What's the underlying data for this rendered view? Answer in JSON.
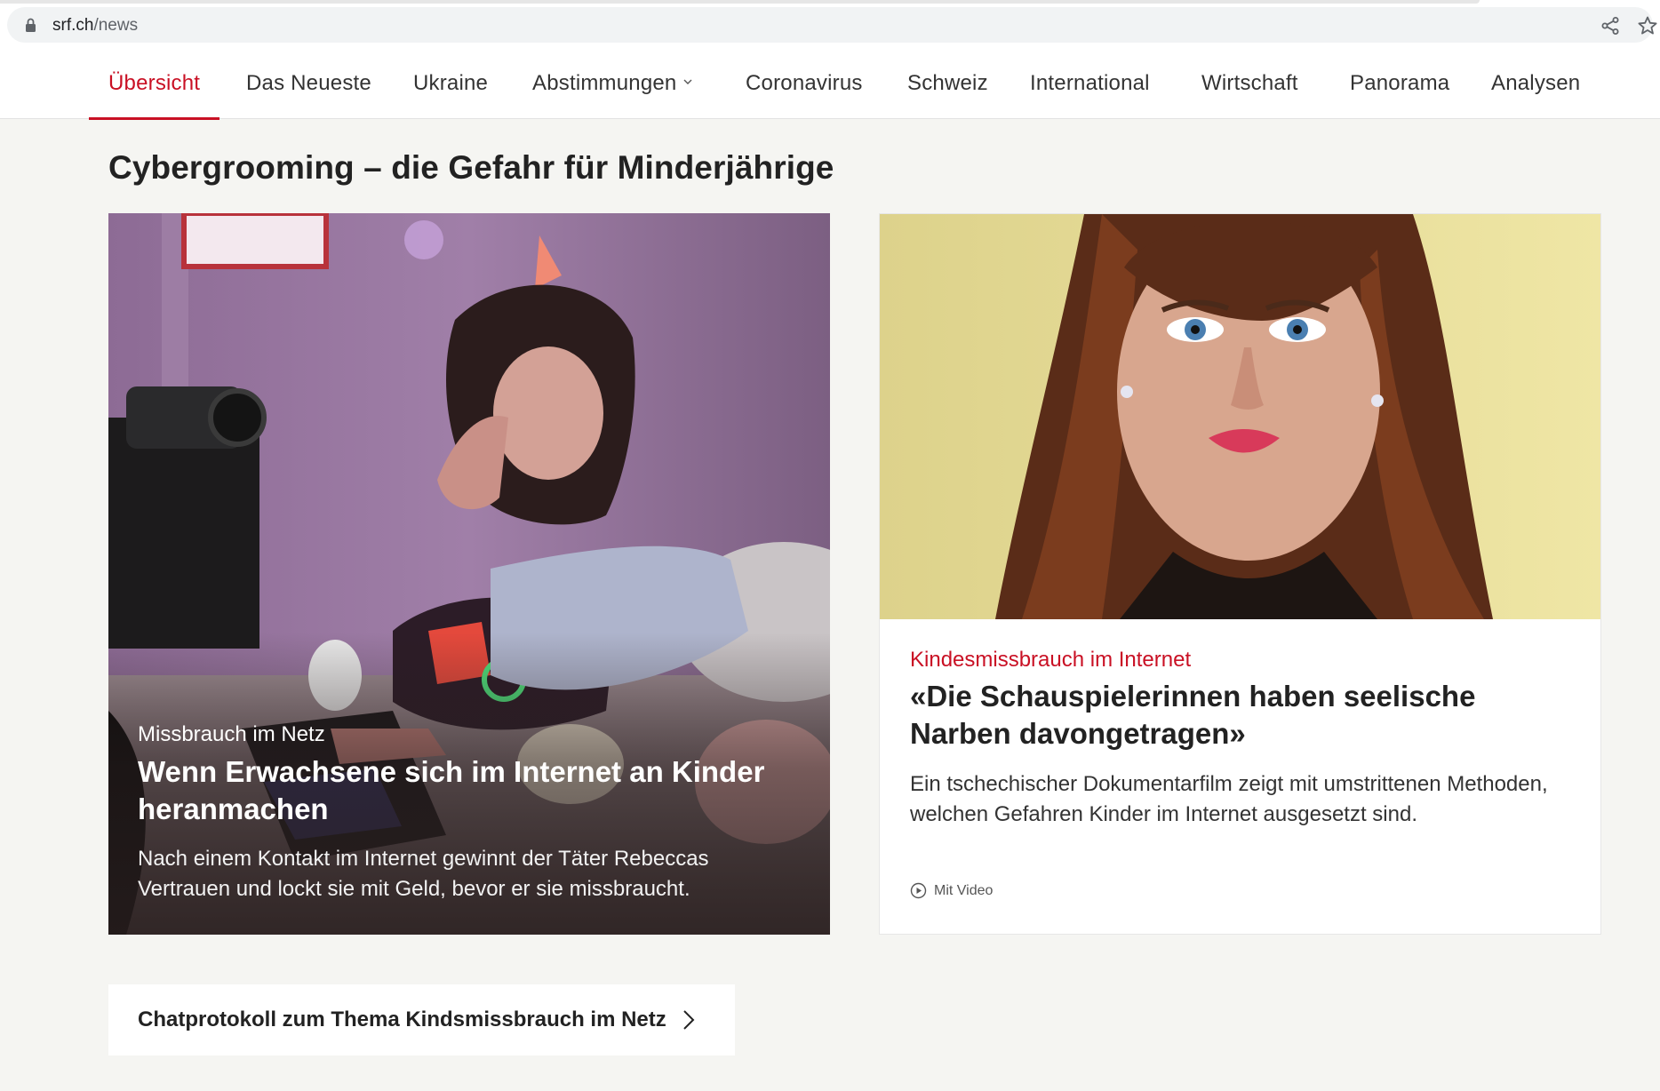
{
  "browser": {
    "url_domain": "srf.ch",
    "url_path": "/news",
    "icons": [
      "lock-icon",
      "share-icon",
      "star-icon"
    ]
  },
  "nav": {
    "items": [
      {
        "label": "Übersicht",
        "active": true
      },
      {
        "label": "Das Neueste"
      },
      {
        "label": "Ukraine"
      },
      {
        "label": "Abstimmungen",
        "has_dropdown": true
      },
      {
        "label": "Coronavirus"
      },
      {
        "label": "Schweiz"
      },
      {
        "label": "International"
      },
      {
        "label": "Wirtschaft"
      },
      {
        "label": "Panorama"
      },
      {
        "label": "Analysen"
      }
    ]
  },
  "section": {
    "title": "Cybergrooming – die Gefahr für Minderjährige"
  },
  "teasers": [
    {
      "kicker": "Missbrauch im Netz",
      "title": "Wenn Erwachsene sich im Internet an Kinder heranmachen",
      "lead": "Nach einem Kontakt im Internet gewinnt der Täter Rebeccas Vertrauen und lockt sie mit Geld, bevor er sie missbraucht."
    },
    {
      "kicker": "Kindesmissbrauch im Internet",
      "title": "«Die Schauspielerinnen haben seelische Narben davongetragen»",
      "lead": "Ein tschechischer Dokumentarfilm zeigt mit umstrittenen Methoden, welchen Gefahren Kinder im Internet ausgesetzt sind.",
      "meta": "Mit Video"
    }
  ],
  "more_link": {
    "label": "Chatprotokoll zum Thema Kindsmissbrauch im Netz"
  },
  "colors": {
    "accent": "#c91024",
    "page_bg": "#f5f5f2"
  }
}
